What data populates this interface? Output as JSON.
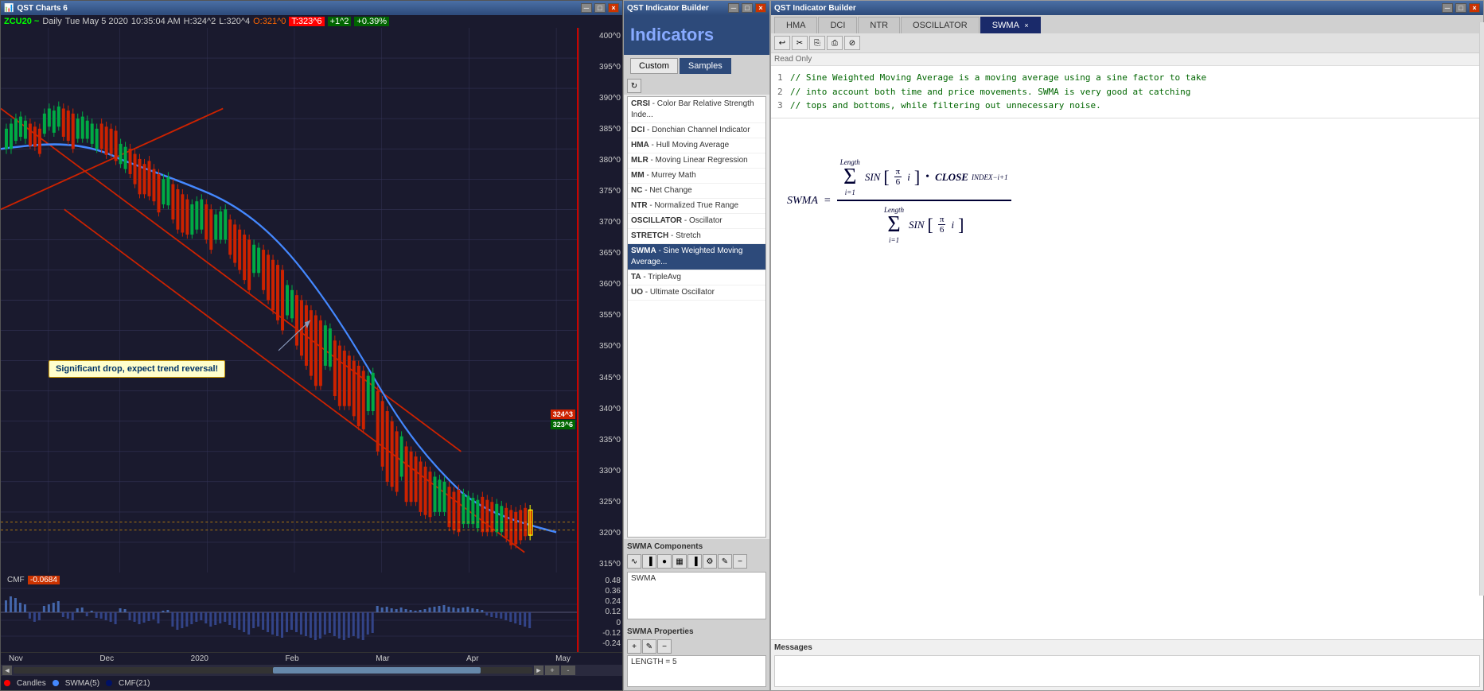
{
  "chartPanel": {
    "titlebar": "QST Charts 6",
    "symbol": "ZCU20 ~",
    "timeframe": "Daily",
    "date": "Tue May 5 2020",
    "time": "10:35:04 AM",
    "high": "H:324^2",
    "low": "L:320^4",
    "open": "O:321^0",
    "last": "T:323^6",
    "change": "+1^2",
    "changePct": "+0.39%",
    "priceLabels": [
      "400^0",
      "395^0",
      "390^0",
      "385^0",
      "380^0",
      "375^0",
      "370^0",
      "365^0",
      "360^0",
      "355^0",
      "350^0",
      "345^0",
      "340^0",
      "335^0",
      "330^0",
      "325^0",
      "320^0",
      "315^0"
    ],
    "cmfLabel": "CMF",
    "cmfValue": "-0.0684",
    "cmfPriceLabels": [
      "0.48",
      "0.36",
      "0.24",
      "0.12",
      "0",
      "-0.12",
      "-0.24"
    ],
    "timelineLabels": [
      "Nov",
      "Dec",
      "2020",
      "Feb",
      "Mar",
      "Apr",
      "May"
    ],
    "annotationText": "Significant drop, expect trend reversal!",
    "legend": {
      "candles": "Candles",
      "swma": "SWMA(5)",
      "cmf": "CMF(21)"
    },
    "windowButtons": [
      "□",
      "─",
      "×"
    ]
  },
  "indicatorPanel": {
    "titlebar": "QST Indicator Builder",
    "title": "Indicators",
    "tabs": [
      {
        "label": "Custom",
        "active": false
      },
      {
        "label": "Samples",
        "active": true
      }
    ],
    "indicators": [
      {
        "code": "CRSI",
        "desc": "Color Bar Relative Strength Inde..."
      },
      {
        "code": "DCI",
        "desc": "Donchian Channel Indicator"
      },
      {
        "code": "HMA",
        "desc": "Hull Moving Average"
      },
      {
        "code": "MLR",
        "desc": "Moving Linear Regression"
      },
      {
        "code": "MM",
        "desc": "Murrey Math"
      },
      {
        "code": "NC",
        "desc": "Net Change"
      },
      {
        "code": "NTR",
        "desc": "Normalized True Range"
      },
      {
        "code": "OSCILLATOR",
        "desc": "Oscillator"
      },
      {
        "code": "STRETCH",
        "desc": "Stretch"
      },
      {
        "code": "SWMA",
        "desc": "Sine Weighted Moving Average...",
        "selected": true
      },
      {
        "code": "TA",
        "desc": "TripleAvg"
      },
      {
        "code": "UO",
        "desc": "Ultimate Oscillator"
      }
    ],
    "componentsLabel": "SWMA Components",
    "componentItem": "SWMA",
    "propertiesLabel": "SWMA Properties",
    "propertyItem": "LENGTH = 5",
    "windowButtons": [
      "─",
      "□",
      "×"
    ]
  },
  "formulaPanel": {
    "titlebar": "QST Indicator Builder",
    "tabs": [
      "HMA",
      "DCI",
      "NTR",
      "OSCILLATOR",
      "SWMA"
    ],
    "activeTab": "SWMA",
    "toolbarIcons": [
      "↩",
      "✂",
      "⎘",
      "⎙",
      "⊘"
    ],
    "readOnlyLabel": "Read Only",
    "codeLines": [
      {
        "num": "1",
        "text": "// Sine Weighted Moving Average is a moving average using a sine factor to take"
      },
      {
        "num": "2",
        "text": "// into account both time and price movements. SWMA is very good at catching"
      },
      {
        "num": "3",
        "text": "// tops and bottoms, while filtering out unnecessary noise."
      }
    ],
    "formulaLabel": "SWMA =",
    "messagesLabel": "Messages",
    "windowButtons": [
      "─",
      "□",
      "×"
    ]
  }
}
